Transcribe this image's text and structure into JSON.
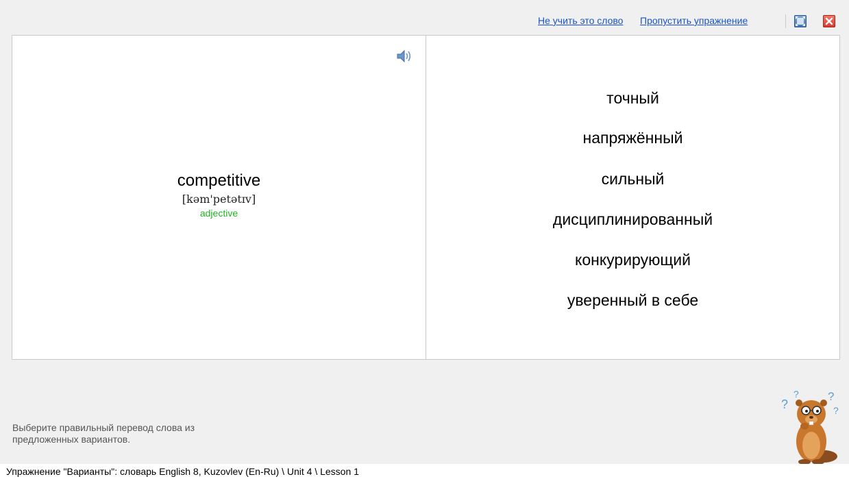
{
  "topbar": {
    "dont_learn_label": "Не учить это слово",
    "skip_label": "Пропустить упражнение"
  },
  "card": {
    "word": "competitive",
    "transcription": "[kəm'petətɪv]",
    "part_of_speech": "adjective",
    "part_of_speech_color": "#22b322"
  },
  "options": [
    "точный",
    "напряжённый",
    "сильный",
    "дисциплинированный",
    "конкурирующий",
    "уверенный в себе"
  ],
  "instruction": {
    "line1": "Выберите правильный перевод слова из",
    "line2": "предложенных вариантов."
  },
  "status": {
    "text": "Упражнение \"Варианты\": словарь English 8, Kuzovlev (En-Ru) \\ Unit 4 \\ Lesson 1"
  },
  "icons": {
    "sound": "speaker-icon",
    "fullscreen": "fullscreen-icon",
    "close": "close-icon",
    "mascot": "beaver-mascot-icon"
  }
}
